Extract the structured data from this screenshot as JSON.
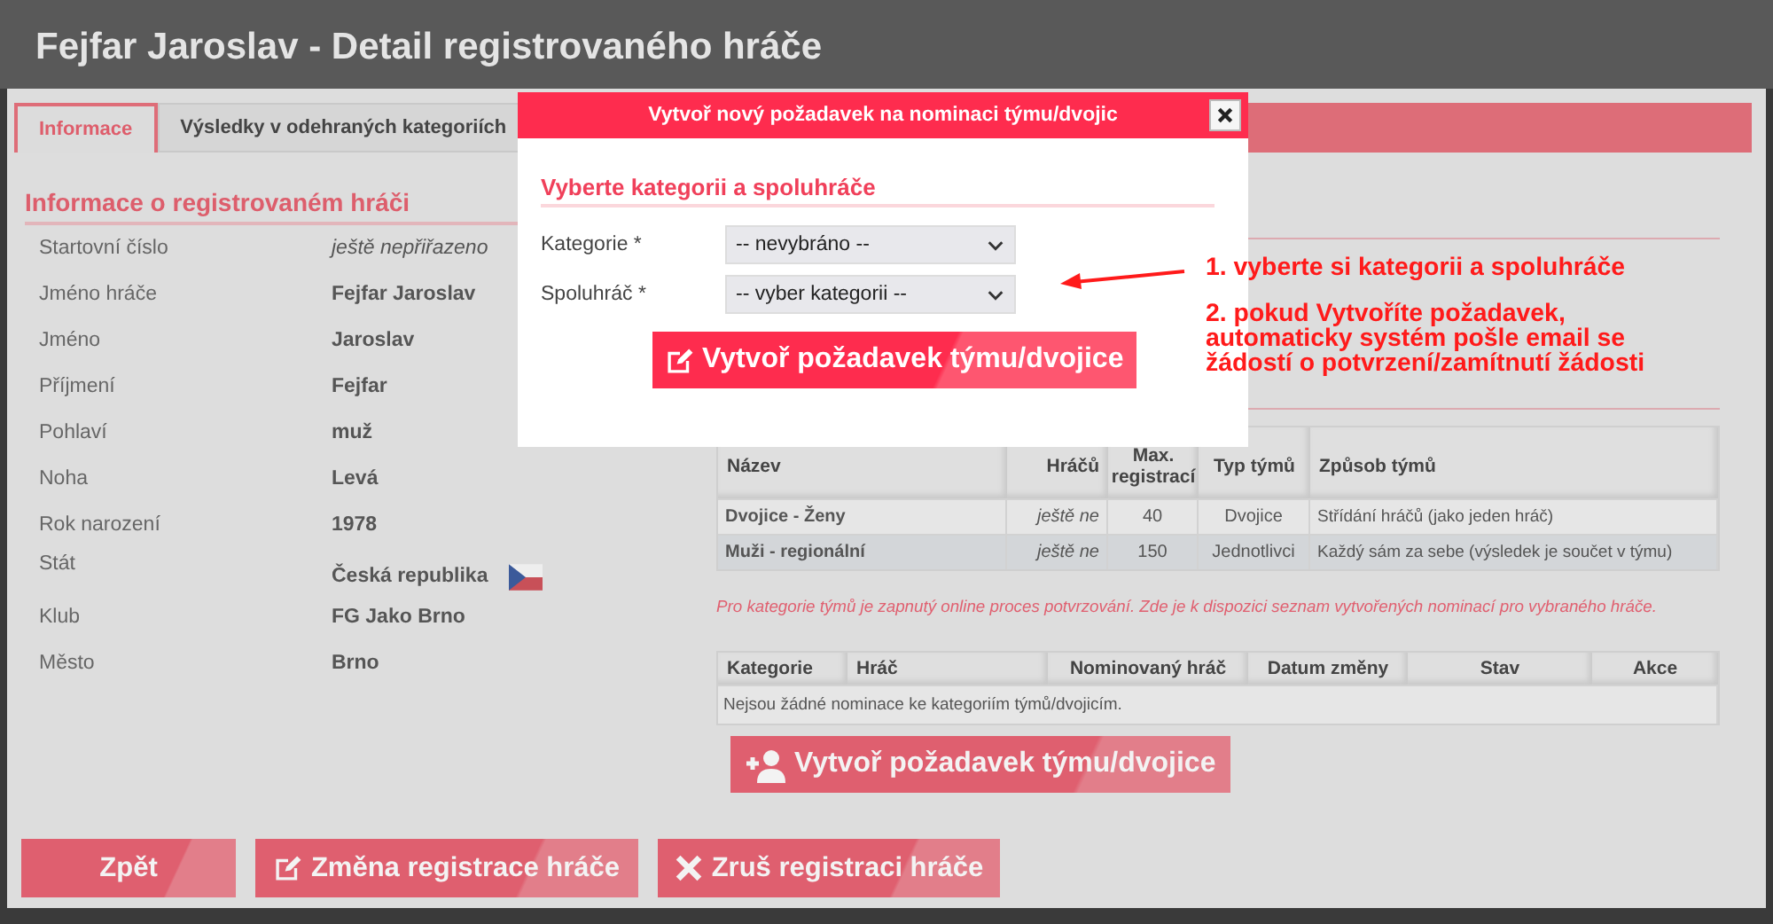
{
  "page_title": "Fejfar Jaroslav - Detail registrovaného hráče",
  "tabs": [
    {
      "label": "Informace",
      "selected": true
    },
    {
      "label": "Výsledky v odehraných kategoriích",
      "selected": false
    }
  ],
  "info": {
    "heading": "Informace o registrovaném hráči",
    "rows": [
      {
        "label": "Startovní číslo",
        "value": "ještě nepřiřazeno",
        "kind": "italic"
      },
      {
        "label": "Jméno hráče",
        "value": "Fejfar Jaroslav",
        "kind": "bold"
      },
      {
        "label": "Jméno",
        "value": "Jaroslav",
        "kind": "bold"
      },
      {
        "label": "Příjmení",
        "value": "Fejfar",
        "kind": "bold"
      },
      {
        "label": "Pohlaví",
        "value": "muž",
        "kind": "bold"
      },
      {
        "label": "Noha",
        "value": "Levá",
        "kind": "bold"
      },
      {
        "label": "Rok narození",
        "value": "1978",
        "kind": "bold"
      },
      {
        "label": "Stát",
        "value": "Česká republika",
        "kind": "country"
      },
      {
        "label": "Klub",
        "value": "FG Jako Brno",
        "kind": "bold"
      },
      {
        "label": "Město",
        "value": "Brno",
        "kind": "bold"
      }
    ]
  },
  "categories_table": {
    "columns": [
      "Název",
      "Hráčů",
      "Max. registrací",
      "Typ týmů",
      "Způsob týmů"
    ],
    "rows": [
      [
        "Dvojice - Ženy",
        "ještě ne",
        "40",
        "Dvojice",
        "Střídání hráčů (jako jeden hráč)"
      ],
      [
        "Muži - regionální",
        "ještě ne",
        "150",
        "Jednotlivci",
        "Každý sám za sebe (výsledek je součet v týmu)"
      ]
    ]
  },
  "note": "Pro kategorie týmů je zapnutý online proces potvrzování. Zde je k dispozici seznam vytvořených nominací pro vybraného hráče.",
  "nominations_table": {
    "columns": [
      "Kategorie",
      "Hráč",
      "Nominovaný hráč",
      "Datum změny",
      "Stav",
      "Akce"
    ],
    "empty_message": "Nejsou žádné nominace ke kategoriím týmů/dvojicím."
  },
  "create_button": {
    "label": "Vytvoř požadavek týmu/dvojice"
  },
  "footer_buttons": [
    {
      "label": "Zpět",
      "kind": "back"
    },
    {
      "label": "Změna registrace hráče",
      "kind": "edit"
    },
    {
      "label": "Zruš registraci hráče",
      "kind": "cancel"
    }
  ],
  "modal": {
    "title": "Vytvoř nový požadavek na nominaci týmu/dvojic",
    "heading": "Vyberte kategorii a spoluhráče",
    "fields": [
      {
        "label": "Kategorie *",
        "value": "-- nevybráno --"
      },
      {
        "label": "Spoluhráč *",
        "value": "-- vyber kategorii --"
      }
    ],
    "submit_button": {
      "label": "Vytvoř požadavek týmu/dvojice"
    }
  },
  "annotations": [
    "1. vyberte si kategorii a spoluhráče",
    "2. pokud Vytvoříte požadavek, automaticky systém pošle email se žádostí o potvrzení/zamítnutí žádosti"
  ]
}
